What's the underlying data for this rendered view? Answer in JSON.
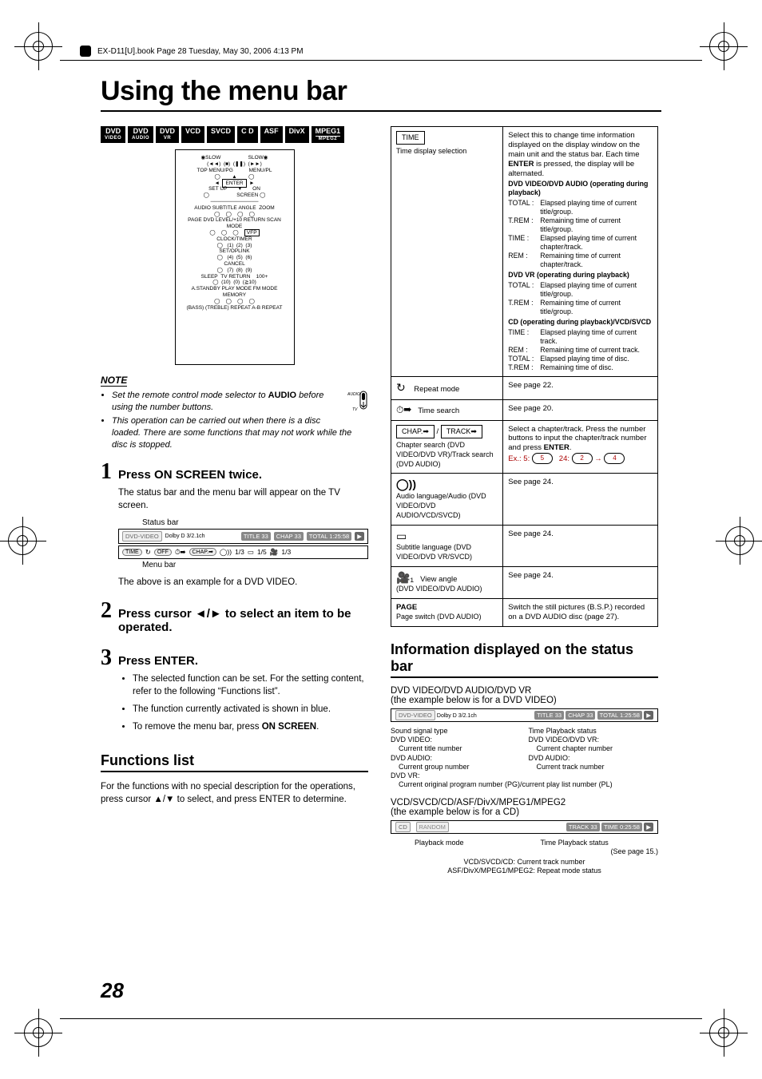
{
  "book_info": "EX-D11[U].book  Page 28  Tuesday, May 30, 2006  4:13 PM",
  "page_title": "Using the menu bar",
  "page_number": "28",
  "badges": [
    "DVD VIDEO",
    "DVD AUDIO",
    "DVD VR",
    "VCD",
    "SVCD",
    "CD",
    "ASF",
    "DivX",
    "MPEG1 MPEG2"
  ],
  "remote": {
    "labels": [
      "SLOW",
      "SLOW",
      "TOP MENU/PG",
      "MENU/PL",
      "ENTER",
      "SET UP",
      "ON SCREEN",
      "AUDIO",
      "SUBTITLE",
      "ANGLE",
      "ZOOM",
      "PAGE",
      "DVD LEVEL/+10",
      "RETURN",
      "SCAN MODE",
      "VFP",
      "CLOCK/TIMER",
      "1",
      "2",
      "3",
      "SET/OPLINK",
      "4",
      "5",
      "6",
      "CANCEL",
      "7",
      "8",
      "9",
      "SLEEP",
      "TV RETURN",
      "100+",
      "10",
      "0",
      "≧10",
      "A.STANDBY",
      "PLAY MODE",
      "FM MODE",
      "MEMORY",
      "BASS",
      "TREBLE",
      "REPEAT A-B",
      "REPEAT"
    ]
  },
  "note": {
    "heading": "NOTE",
    "items": [
      "Set the remote control mode selector to AUDIO before using the number buttons.",
      "This operation can be carried out when there is a disc loaded. There are some functions that may not work while the disc is stopped."
    ],
    "icon_label_top": "AUDIO",
    "icon_label_bottom": "TV"
  },
  "steps": {
    "s1_head": "Press ON SCREEN twice.",
    "s1_text": "The status bar and the menu bar will appear on the TV screen.",
    "s1_label_status": "Status bar",
    "s1_label_menu": "Menu bar",
    "s1_caption": "The above is an example for a DVD VIDEO.",
    "s2_head_a": "Press cursor ",
    "s2_head_b": " to select an item to be operated.",
    "s2_arrows": "◄/►",
    "s3_head": "Press ENTER.",
    "s3_bullets": [
      "The selected function can be set. For the setting content, refer to the following “Functions list”.",
      "The function currently activated is shown in blue.",
      "To remove the menu bar, press ON SCREEN."
    ]
  },
  "status_fig": {
    "dvd_video": "DVD-VIDEO",
    "dolby": "Dolby D 3/2.1ch",
    "title": "TITLE 33",
    "chap": "CHAP 33",
    "total": "TOTAL  1:25:58",
    "play": "▶",
    "menubar": {
      "time": "TIME",
      "repeat_off": "OFF",
      "chap_arrow": "CHAP.➡",
      "v13a": "1/3",
      "v15": "1/5",
      "v13b": "1/3"
    }
  },
  "functions_list": {
    "heading": "Functions list",
    "intro_a": "For the functions with no special description for the operations, press cursor ",
    "intro_arrows": "▲/▼",
    "intro_b": " to select, and press ENTER to determine."
  },
  "table": {
    "time": {
      "box": "TIME",
      "caption": "Time display selection",
      "intro": "Select this to change time information displayed on the display window on the main unit and the status bar. Each time ENTER is pressed, the display will be alternated.",
      "h1": "DVD VIDEO/DVD AUDIO (operating during playback)",
      "d1": [
        [
          "TOTAL :",
          "Elapsed playing time of current title/group."
        ],
        [
          "T.REM :",
          "Remaining time of current title/group."
        ],
        [
          "TIME :",
          "Elapsed playing time of current chapter/track."
        ],
        [
          "REM :",
          "Remaining time of current chapter/track."
        ]
      ],
      "h2": "DVD VR (operating during playback)",
      "d2": [
        [
          "TOTAL :",
          "Elapsed playing time of current title/group."
        ],
        [
          "T.REM :",
          "Remaining time of current title/group."
        ]
      ],
      "h3": "CD (operating during playback)/VCD/SVCD",
      "d3": [
        [
          "TIME :",
          "Elapsed playing time of current track."
        ],
        [
          "REM :",
          "Remaining time of current track."
        ],
        [
          "TOTAL :",
          "Elapsed playing time of disc."
        ],
        [
          "T.REM :",
          "Remaining time of disc."
        ]
      ]
    },
    "repeat": {
      "label": "Repeat mode",
      "right": "See page 22."
    },
    "timesearch": {
      "label": "Time search",
      "right": "See page 20."
    },
    "chap": {
      "box1": "CHAP.➡",
      "box2": "TRACK➡",
      "sep": "/",
      "caption": "Chapter search (DVD VIDEO/DVD VR)/Track search (DVD AUDIO)",
      "right_a": "Select a chapter/track. Press the number buttons to input the chapter/track number and press ENTER.",
      "ex_label": "Ex.:",
      "ex_a": "5:",
      "ex_b": "24:",
      "btn5": "5",
      "btn2": "2",
      "btn4": "4"
    },
    "audio_lang": {
      "caption": "Audio language/Audio (DVD VIDEO/DVD AUDIO/VCD/SVCD)",
      "right": "See page 24."
    },
    "subtitle": {
      "caption": "Subtitle language (DVD VIDEO/DVD VR/SVCD)",
      "right": "See page 24."
    },
    "angle": {
      "label": "View angle",
      "caption": "(DVD VIDEO/DVD AUDIO)",
      "right": "See page 24."
    },
    "page": {
      "box": "PAGE",
      "caption": "Page switch (DVD AUDIO)",
      "right": "Switch the still pictures (B.S.P.) recorded on a DVD AUDIO disc (page 27)."
    }
  },
  "info_section": {
    "heading": "Information displayed on the status bar",
    "sub1a": "DVD VIDEO/DVD AUDIO/DVD VR",
    "sub1b": "(the example below is for a DVD VIDEO)",
    "fig1": {
      "dvd_video": "DVD-VIDEO",
      "dolby": "Dolby D 3/2.1ch",
      "title": "TITLE 33",
      "chap": "CHAP 33",
      "total": "TOTAL  1:25:58",
      "play": "▶"
    },
    "callouts1_left": [
      "Sound signal type",
      "DVD VIDEO:",
      "  Current title number",
      "DVD AUDIO:",
      "  Current group number",
      "DVD VR:",
      "  Current original program number (PG)/current play list number (PL)"
    ],
    "callouts1_right": [
      "Time  Playback status",
      "DVD VIDEO/DVD VR:",
      "  Current chapter number",
      "DVD AUDIO:",
      "  Current track number"
    ],
    "sub2a": "VCD/SVCD/CD/ASF/DivX/MPEG1/MPEG2",
    "sub2b": "(the example below is for a CD)",
    "fig2": {
      "cd": "CD",
      "random": "RANDOM",
      "track": "TRACK 33",
      "time": "TIME  0:25:58",
      "play": "▶"
    },
    "callouts2_left": [
      "Playback mode"
    ],
    "callouts2_right": [
      "Time  Playback status",
      "(See page 15.)"
    ],
    "callouts2_bottom": [
      "VCD/SVCD/CD: Current track number",
      "ASF/DivX/MPEG1/MPEG2: Repeat mode status"
    ]
  }
}
